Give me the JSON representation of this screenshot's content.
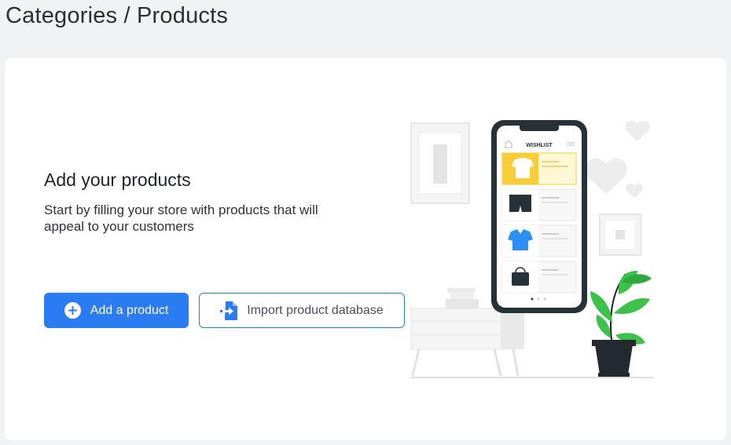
{
  "header": {
    "title": "Categories / Products"
  },
  "empty_state": {
    "title": "Add your products",
    "description": "Start by filling your store with products that will appeal to your customers",
    "primary_button_label": "Add a product",
    "secondary_button_label": "Import product database",
    "illustration": {
      "app_title": "WISHLIST",
      "products": [
        "t-shirt-icon",
        "shorts-icon",
        "shirt-icon",
        "handbag-icon"
      ]
    }
  },
  "colors": {
    "primary": "#2b7bf3",
    "secondary_border": "#1f8ab0",
    "highlight": "#f9cc3a",
    "plant": "#3cc24a"
  }
}
